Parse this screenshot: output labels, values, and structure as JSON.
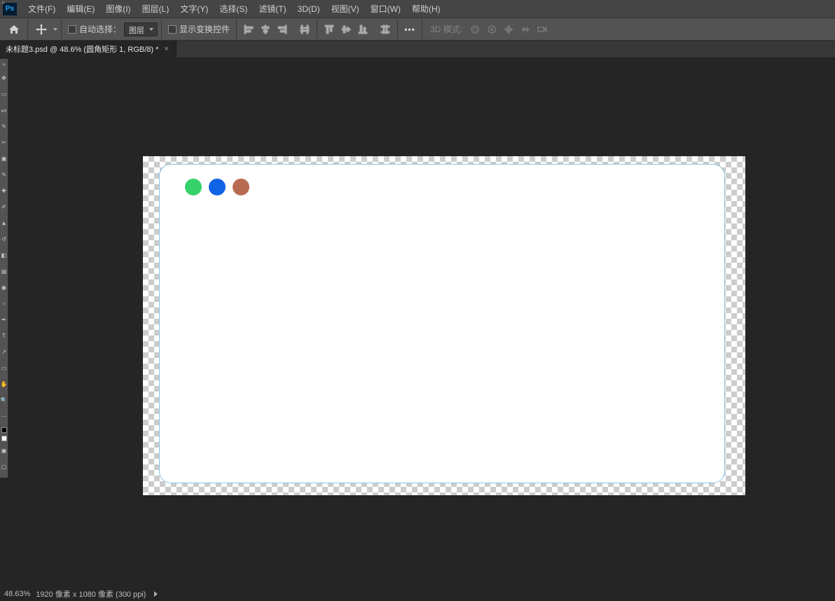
{
  "app_icon": "Ps",
  "menu": {
    "file": "文件(F)",
    "edit": "编辑(E)",
    "image": "图像(I)",
    "layer": "图层(L)",
    "type": "文字(Y)",
    "select": "选择(S)",
    "filter": "滤镜(T)",
    "three_d": "3D(D)",
    "view": "视图(V)",
    "window": "窗口(W)",
    "help": "帮助(H)"
  },
  "options": {
    "auto_select_label": "自动选择：",
    "auto_select_target": "图层",
    "show_transform_label": "显示变换控件",
    "mode_3d_label": "3D 模式:"
  },
  "tab": {
    "title": "未标题3.psd @ 48.6% (圆角矩形 1, RGB/8) *"
  },
  "canvas_artwork": {
    "shape_name": "圆角矩形 1",
    "dots": [
      "green",
      "blue",
      "brown"
    ]
  },
  "status": {
    "zoom": "48.63%",
    "doc_info": "1920 像素 x 1080 像素 (300 ppi)"
  }
}
